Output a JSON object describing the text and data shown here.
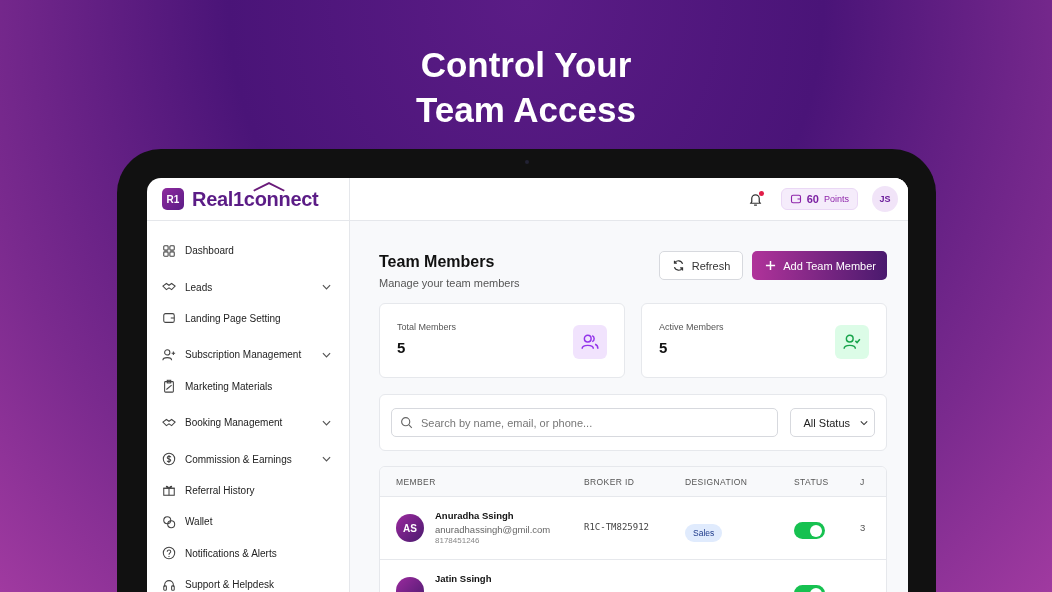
{
  "headline_lines": [
    "Control Your",
    "Team Access"
  ],
  "logo": {
    "badge": "R1",
    "name": "Real1connect"
  },
  "sidebar": {
    "items": [
      {
        "label": "Dashboard",
        "expandable": false
      },
      {
        "label": "Leads",
        "expandable": true
      },
      {
        "label": "Landing Page Setting",
        "expandable": false
      },
      {
        "label": "Subscription Management",
        "expandable": true
      },
      {
        "label": "Marketing Materials",
        "expandable": false
      },
      {
        "label": "Booking Management",
        "expandable": true
      },
      {
        "label": "Commission & Earnings",
        "expandable": true
      },
      {
        "label": "Referral History",
        "expandable": false
      },
      {
        "label": "Wallet",
        "expandable": false
      },
      {
        "label": "Notifications & Alerts",
        "expandable": false
      },
      {
        "label": "Support & Helpdesk",
        "expandable": false
      }
    ]
  },
  "topbar": {
    "has_unread": true,
    "points": "60",
    "points_label": "Points",
    "avatar": "JS"
  },
  "page": {
    "title": "Team Members",
    "subtitle": "Manage your team members",
    "buttons": [
      {
        "label": "Refresh",
        "kind": "secondary"
      },
      {
        "label": "Add Team Member",
        "kind": "primary"
      }
    ]
  },
  "stats": [
    {
      "label": "Total Members",
      "value": "5",
      "kind": "total"
    },
    {
      "label": "Active Members",
      "value": "5",
      "kind": "active"
    }
  ],
  "filters": {
    "search": {
      "placeholder": "Search by name, email, or phone..."
    },
    "status": "All Status"
  },
  "table": {
    "columns": [
      "MEMBER",
      "BROKER ID",
      "DESIGNATION",
      "STATUS",
      "J"
    ],
    "rows": [
      {
        "initials": "AS",
        "name": "Anuradha Ssingh",
        "email": "anuradhassingh@gmil.com",
        "phone": "8178451246",
        "broker_id": "R1C-TM825912",
        "designation": "Sales",
        "on": true,
        "column_5": "3"
      },
      {
        "name": "Jatin Ssingh",
        "on": true
      }
    ]
  }
}
